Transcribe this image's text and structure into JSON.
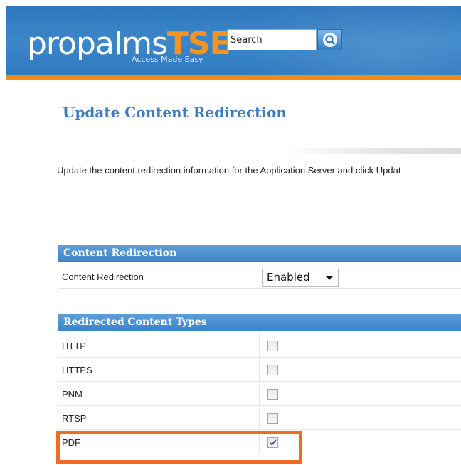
{
  "header": {
    "logo_light": "propalms",
    "logo_brand": "TSE",
    "tagline": "Access Made Easy",
    "search_value": "Search",
    "colors": {
      "header": "#3079bf",
      "accent": "#f28a1a"
    }
  },
  "page": {
    "title": "Update Content Redirection",
    "intro": "Update the content redirection information for the Application Server and click Updat"
  },
  "content_redirection": {
    "section_title": "Content Redirection",
    "row_label": "Content Redirection",
    "selected_value": "Enabled"
  },
  "content_types": {
    "section_title": "Redirected Content Types",
    "items": [
      {
        "label": "HTTP",
        "checked": false
      },
      {
        "label": "HTTPS",
        "checked": false
      },
      {
        "label": "PNM",
        "checked": false
      },
      {
        "label": "RTSP",
        "checked": false
      },
      {
        "label": "PDF",
        "checked": true
      }
    ]
  },
  "icons": {
    "search": "search-icon",
    "dropdown": "chevron-down-icon",
    "check": "check-icon"
  },
  "highlight_color": "#f26c1f"
}
